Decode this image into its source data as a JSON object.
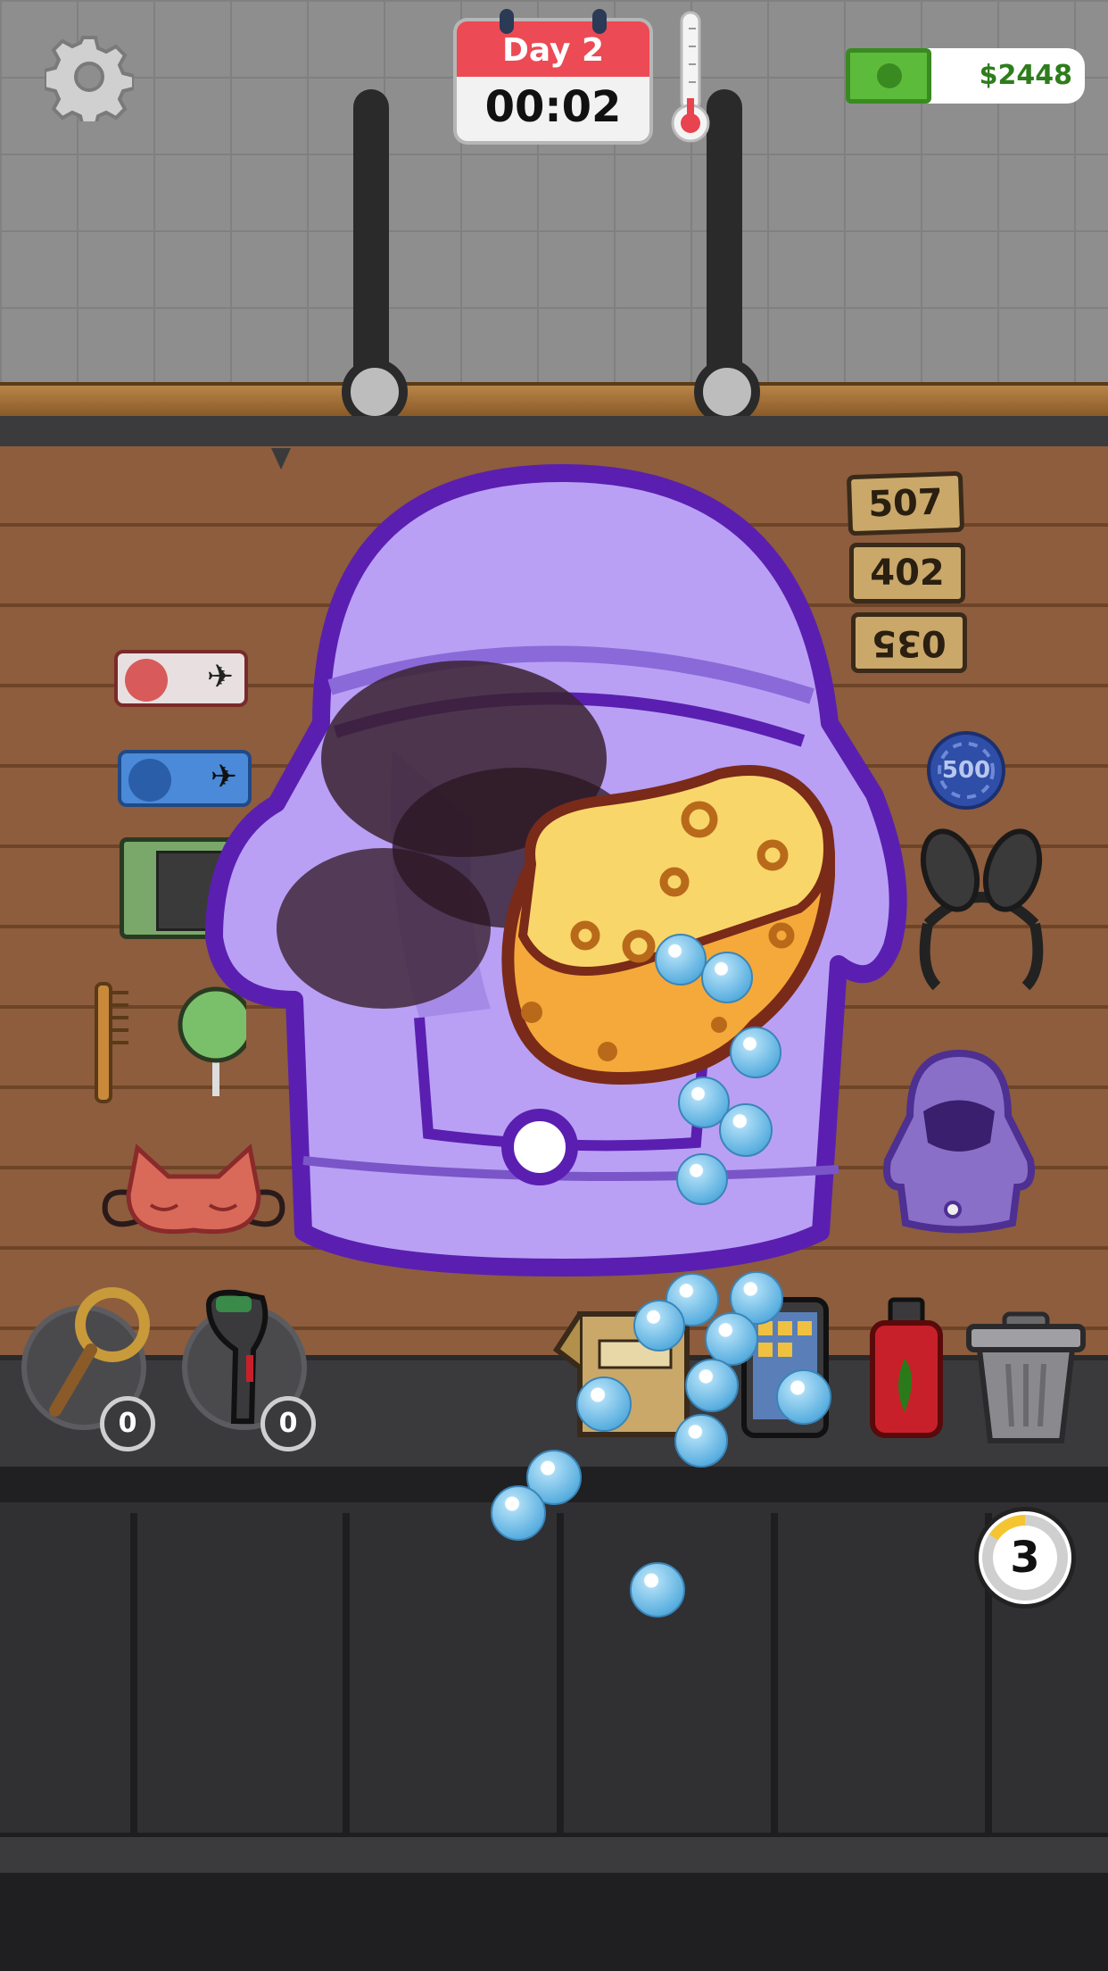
{
  "hud": {
    "day_label": "Day 2",
    "timer": "00:02",
    "money": "$2448",
    "icons": [
      "gear-icon",
      "thermometer-icon",
      "cash-icon"
    ]
  },
  "room_tags": [
    "507",
    "402",
    "035"
  ],
  "items": {
    "chip_value": "500",
    "labels": [
      "plane-ticket-red",
      "plane-ticket-blue",
      "tablet",
      "comb",
      "lollipop",
      "sleep-mask",
      "bunny-ears-headband",
      "purple-coat",
      "cardboard-box",
      "phone",
      "hot-sauce",
      "trash-can"
    ]
  },
  "tools": {
    "magnifier_count": "0",
    "scanner_count": "0"
  },
  "customers_remaining": "3",
  "colors": {
    "coat_fill": "#b9a0f5",
    "coat_outline": "#5a1fb0",
    "sponge": "#f7c44a",
    "money_text": "#2e7d1c",
    "calendar_red": "#ec4a55"
  }
}
